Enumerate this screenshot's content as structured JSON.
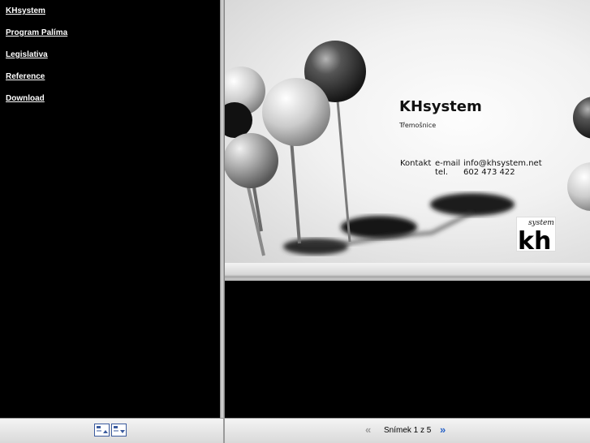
{
  "nav": {
    "items": [
      {
        "label": "KHsystem"
      },
      {
        "label": "Program Palíma"
      },
      {
        "label": "Legislativa"
      },
      {
        "label": "Reference"
      },
      {
        "label": "Download"
      }
    ]
  },
  "slide": {
    "company": "KHsystem",
    "city": "Třemošnice",
    "contact_label": "Kontakt",
    "email_label": "e-mail",
    "email_value": "info@khsystem.net",
    "tel_label": "tel.",
    "tel_value": "602 473 422",
    "logo": {
      "script_text": "system",
      "letters": "kh"
    }
  },
  "toolbar": {
    "left_icons": [
      "expand-frames-icon",
      "collapse-frames-icon"
    ],
    "slide_counter": "Snímek 1 z 5",
    "prev_icon": "double-chevron-left-icon",
    "next_icon": "double-chevron-right-icon",
    "accent_color": "#2b64c8"
  }
}
